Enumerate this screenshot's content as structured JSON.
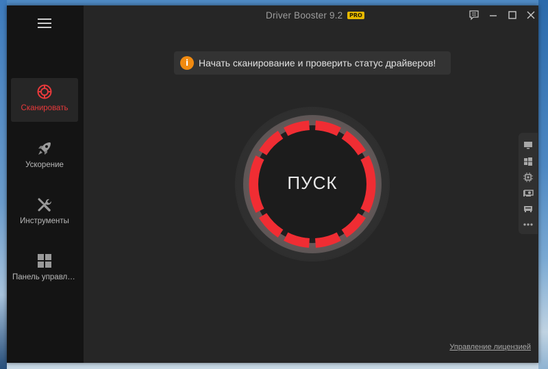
{
  "window": {
    "app_name": "Driver Booster 9.2",
    "edition_badge": "PRO"
  },
  "sidebar": {
    "items": [
      {
        "label": "Сканировать",
        "icon": "scan-target-icon",
        "active": true
      },
      {
        "label": "Ускорение",
        "icon": "rocket-icon",
        "active": false
      },
      {
        "label": "Инструменты",
        "icon": "tools-wrench-icon",
        "active": false
      },
      {
        "label": "Панель управлен...",
        "icon": "grid-tiles-icon",
        "active": false
      }
    ]
  },
  "notice": {
    "icon": "info-icon",
    "text": "Начать сканирование и проверить статус драйверов!"
  },
  "scan_button": {
    "label": "ПУСК"
  },
  "dock": {
    "items": [
      "monitor-icon",
      "windows-icon",
      "chip-icon",
      "gpu-card-icon",
      "network-card-icon",
      "more-dots-icon"
    ]
  },
  "footer": {
    "license_link": "Управление лицензией"
  },
  "colors": {
    "accent": "#e8393b",
    "badge": "#e7b900",
    "info": "#f08a10"
  }
}
